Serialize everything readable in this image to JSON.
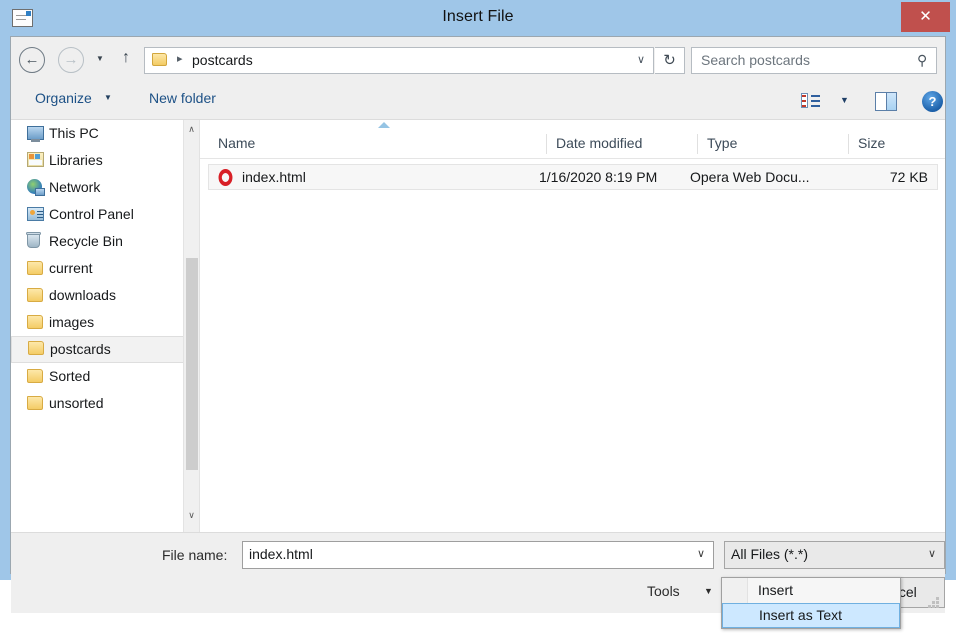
{
  "window": {
    "title": "Insert File",
    "title_icon": "mail-document-icon",
    "close_label": "✕",
    "accent_color": "#9fc6e8",
    "close_color": "#c0504d"
  },
  "navbar": {
    "back_icon": "←",
    "forward_icon": "→",
    "recent_caret": "▼",
    "up_icon": "↑",
    "path_separator": "▸",
    "path": "postcards",
    "address_chevron": "∨",
    "refresh_icon": "↻",
    "search_placeholder": "Search postcards",
    "search_icon": "⚲"
  },
  "commandbar": {
    "organize_label": "Organize",
    "organize_caret": "▼",
    "new_folder_label": "New folder",
    "view_caret": "▼",
    "help_label": "?"
  },
  "sidebar": {
    "items": [
      {
        "label": "This PC",
        "icon": "monitor-icon",
        "icon_class": "ic-pc",
        "selected": false
      },
      {
        "label": "Libraries",
        "icon": "libraries-icon",
        "icon_class": "ic-lib",
        "selected": false
      },
      {
        "label": "Network",
        "icon": "network-globe-icon",
        "icon_class": "ic-net",
        "selected": false
      },
      {
        "label": "Control Panel",
        "icon": "control-panel-icon",
        "icon_class": "ic-cp",
        "selected": false
      },
      {
        "label": "Recycle Bin",
        "icon": "recycle-bin-icon",
        "icon_class": "ic-bin",
        "selected": false
      },
      {
        "label": "current",
        "icon": "folder-icon",
        "icon_class": "ic-folder",
        "selected": false
      },
      {
        "label": "downloads",
        "icon": "folder-icon",
        "icon_class": "ic-folder",
        "selected": false
      },
      {
        "label": "images",
        "icon": "folder-icon",
        "icon_class": "ic-folder",
        "selected": false
      },
      {
        "label": "postcards",
        "icon": "folder-icon",
        "icon_class": "ic-folder",
        "selected": true
      },
      {
        "label": "Sorted",
        "icon": "folder-icon",
        "icon_class": "ic-folder",
        "selected": false
      },
      {
        "label": "unsorted",
        "icon": "folder-icon",
        "icon_class": "ic-folder",
        "selected": false
      }
    ],
    "scroll_up_icon": "∧",
    "scroll_down_icon": "∨"
  },
  "filelist": {
    "columns": [
      "Name",
      "Date modified",
      "Type",
      "Size"
    ],
    "sort_column": "Name",
    "sort_direction": "ascending",
    "rows": [
      {
        "name": "index.html",
        "date_modified": "1/16/2020 8:19 PM",
        "type": "Opera Web Docu...",
        "size": "72 KB",
        "icon": "opera-icon",
        "selected": true
      }
    ]
  },
  "footer": {
    "filename_label": "File name:",
    "filename_value": "index.html",
    "filename_chevron": "∨",
    "filter_value": "All Files (*.*)",
    "filter_chevron": "∨",
    "tools_label": "Tools",
    "tools_caret": "▼",
    "insert_label": "Insert",
    "insert_caret": "▼",
    "cancel_label": "Cancel"
  },
  "insert_menu": {
    "open": true,
    "items": [
      {
        "label": "Insert",
        "highlighted": false
      },
      {
        "label": "Insert as Text",
        "highlighted": true
      }
    ]
  }
}
